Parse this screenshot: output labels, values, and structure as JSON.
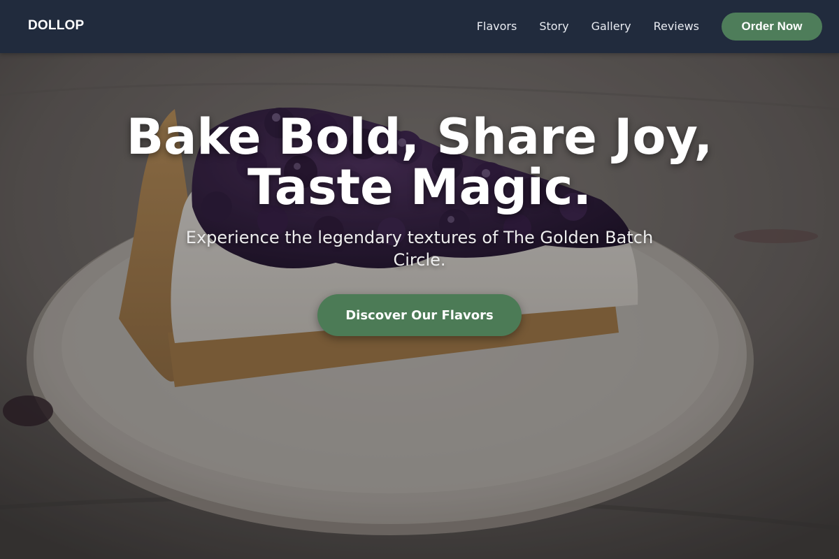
{
  "navbar": {
    "brand": "DOLLOP",
    "links": [
      {
        "label": "Flavors"
      },
      {
        "label": "Story"
      },
      {
        "label": "Gallery"
      },
      {
        "label": "Reviews"
      }
    ],
    "cta_label": "Order Now"
  },
  "hero": {
    "title_line1": "Bake Bold, Share Joy,",
    "title_line2": "Taste Magic.",
    "subtitle": "Experience the legendary textures of The Golden Batch Circle.",
    "cta_label": "Discover Our Flavors"
  },
  "colors": {
    "navbar_bg": "#212b3d",
    "accent_green": "#4e7d5a",
    "text_white": "#ffffff"
  }
}
